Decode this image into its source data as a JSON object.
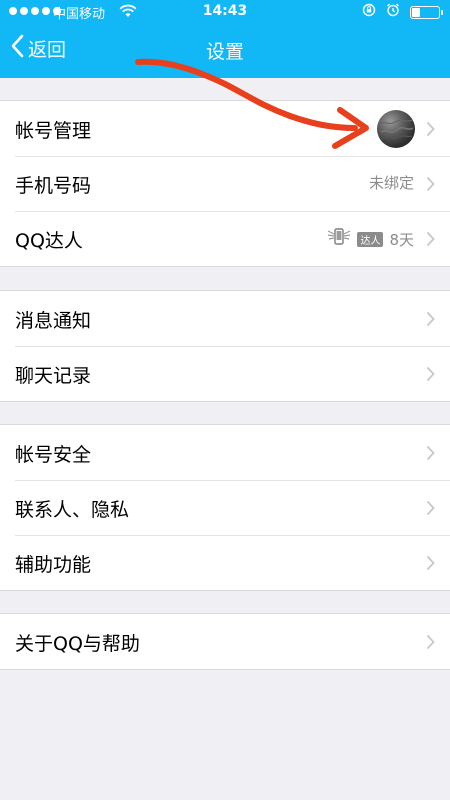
{
  "status_bar": {
    "carrier": "中国移动",
    "time": "14:43"
  },
  "nav": {
    "back_label": "返回",
    "title": "设置"
  },
  "section1": {
    "account_label": "帐号管理",
    "phone_label": "手机号码",
    "phone_value": "未绑定",
    "talent_label": "QQ达人",
    "talent_badge": "达人",
    "talent_days": "8天"
  },
  "section2": {
    "messages_label": "消息通知",
    "chat_label": "聊天记录"
  },
  "section3": {
    "security_label": "帐号安全",
    "privacy_label": "联系人、隐私",
    "accessibility_label": "辅助功能"
  },
  "section4": {
    "about_label": "关于QQ与帮助"
  },
  "colors": {
    "nav_bg": "#12b7f5",
    "page_bg": "#efeff4",
    "annotation_arrow": "#e8401c"
  },
  "icons": {
    "back": "chevron-left-icon",
    "row": "chevron-right-icon",
    "wifi": "wifi-icon",
    "lock": "rotation-lock-icon",
    "alarm": "alarm-icon",
    "battery": "battery-icon"
  }
}
